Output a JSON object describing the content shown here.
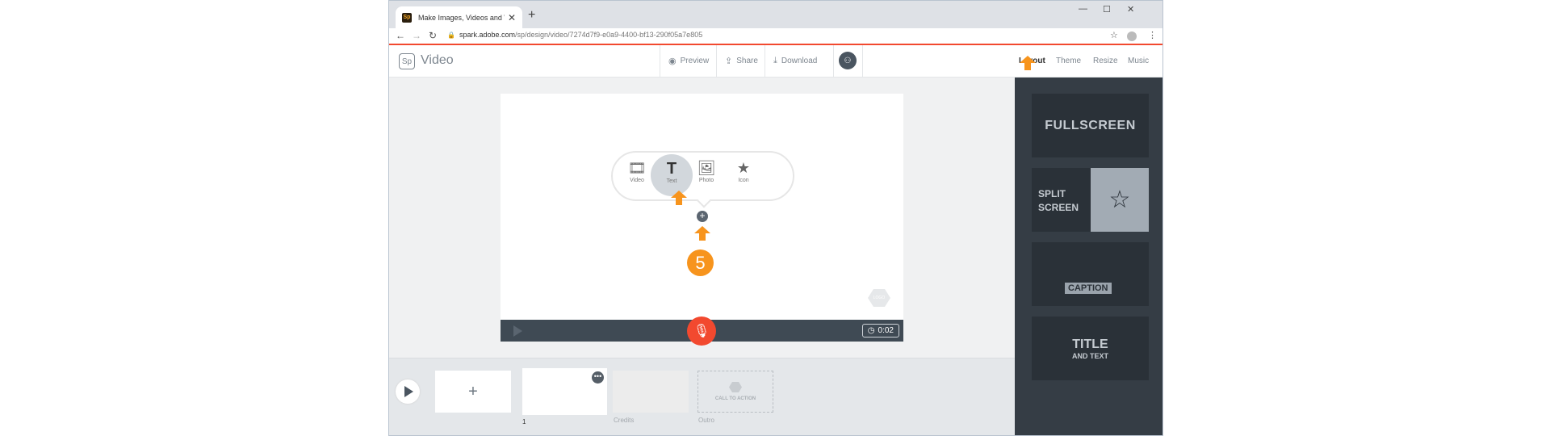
{
  "browser": {
    "tab_title": "Make Images, Videos and Web S",
    "tab_favicon": "Sp",
    "url_domain": "spark.adobe.com",
    "url_path": "/sp/design/video/7274d7f9-e0a9-4400-bf13-290f05a7e805"
  },
  "header": {
    "logo": "Sp",
    "app_name": "Video",
    "preview_label": "Preview",
    "share_label": "Share",
    "download_label": "Download",
    "right_tabs": [
      "Layout",
      "Theme",
      "Resize",
      "Music"
    ]
  },
  "stage": {
    "options": [
      {
        "label": "Video",
        "icon": "film-icon"
      },
      {
        "label": "Text",
        "icon": "text-icon"
      },
      {
        "label": "Photo",
        "icon": "photo-icon"
      },
      {
        "label": "Icon",
        "icon": "star-icon"
      }
    ],
    "step_number": "5",
    "duration": "0:02",
    "badge": "LOGO"
  },
  "timeline": {
    "slide_number": "1",
    "credits_label": "Credits",
    "outro_label": "Outro",
    "outro_cta": "CALL TO ACTION"
  },
  "layouts": {
    "fullscreen": "FULLSCREEN",
    "split_line1": "SPLIT",
    "split_line2": "SCREEN",
    "caption": "CAPTION",
    "title_main": "TITLE",
    "title_sub": "AND TEXT"
  },
  "colors": {
    "accent": "#f2492f",
    "highlight_arrow": "#f7941d",
    "panel_bg": "#353d45"
  }
}
